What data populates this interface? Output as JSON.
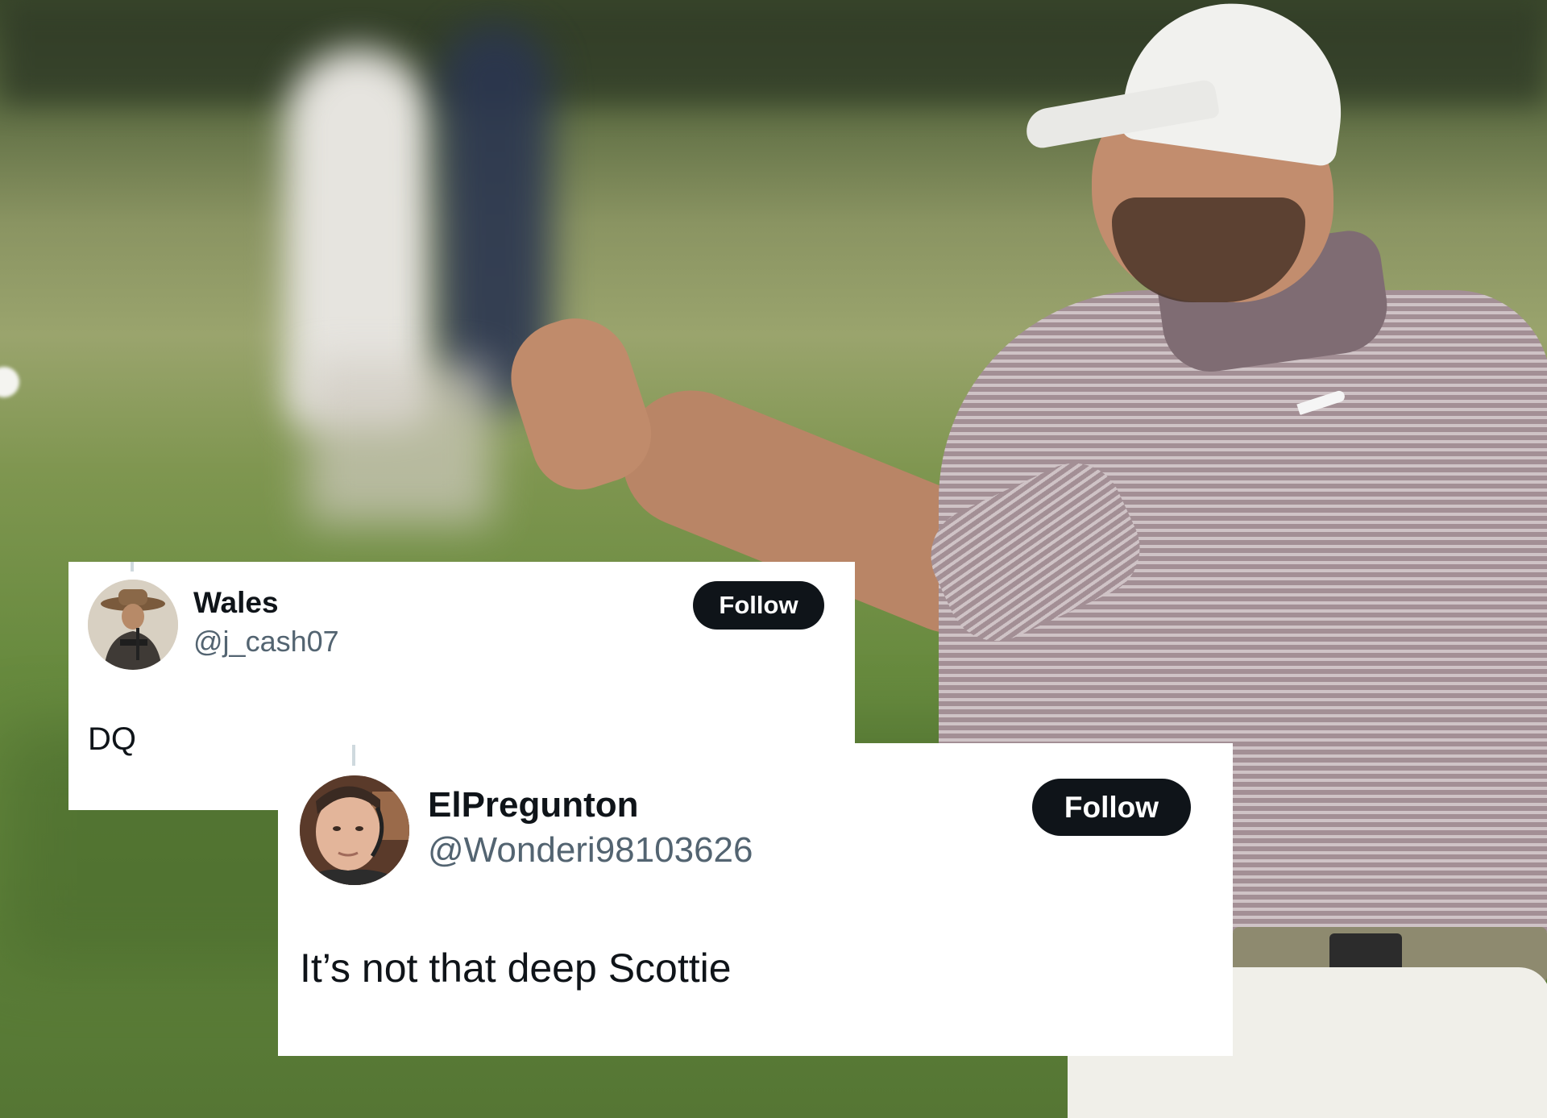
{
  "background": {
    "description_icon": "golfer-photo",
    "accent_grass": "#678a3e"
  },
  "tweets": [
    {
      "display_name": "Wales",
      "handle": "@j_cash07",
      "follow_label": "Follow",
      "text": "DQ",
      "avatar_icon": "cowboy-avatar-icon"
    },
    {
      "display_name": "ElPregunton",
      "handle": "@Wonderi98103626",
      "follow_label": "Follow",
      "text": "It’s not that deep Scottie",
      "avatar_icon": "selfie-avatar-icon"
    }
  ],
  "colors": {
    "follow_button_bg": "#0f1419",
    "handle_text": "#536471",
    "card_bg": "#ffffff"
  }
}
